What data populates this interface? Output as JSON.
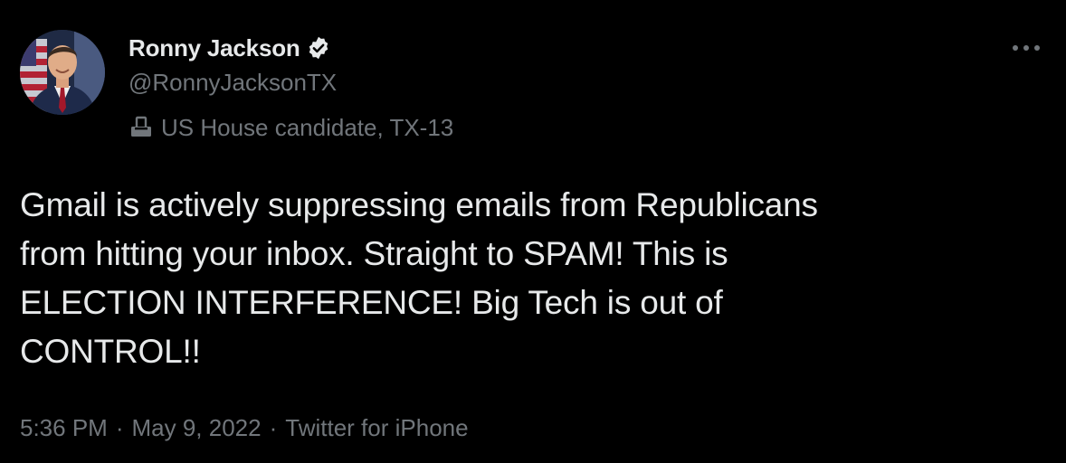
{
  "author": {
    "display_name": "Ronny Jackson",
    "handle": "@RonnyJacksonTX",
    "verified": true,
    "affiliation": "US House candidate, TX-13",
    "avatar_icon": "profile-photo",
    "verified_icon": "verified-badge-icon",
    "affiliation_icon": "ballot-box-icon"
  },
  "tweet": {
    "text": "Gmail is actively suppressing emails from Republicans\nfrom hitting your inbox. Straight to SPAM! This is\nELECTION INTERFERENCE! Big Tech is out of\nCONTROL!!",
    "time": "5:36 PM",
    "date": "May 9, 2022",
    "source": "Twitter for iPhone",
    "separator": "·"
  },
  "colors": {
    "background": "#000000",
    "primary_text": "#e7e9ea",
    "secondary_text": "#71767b"
  }
}
